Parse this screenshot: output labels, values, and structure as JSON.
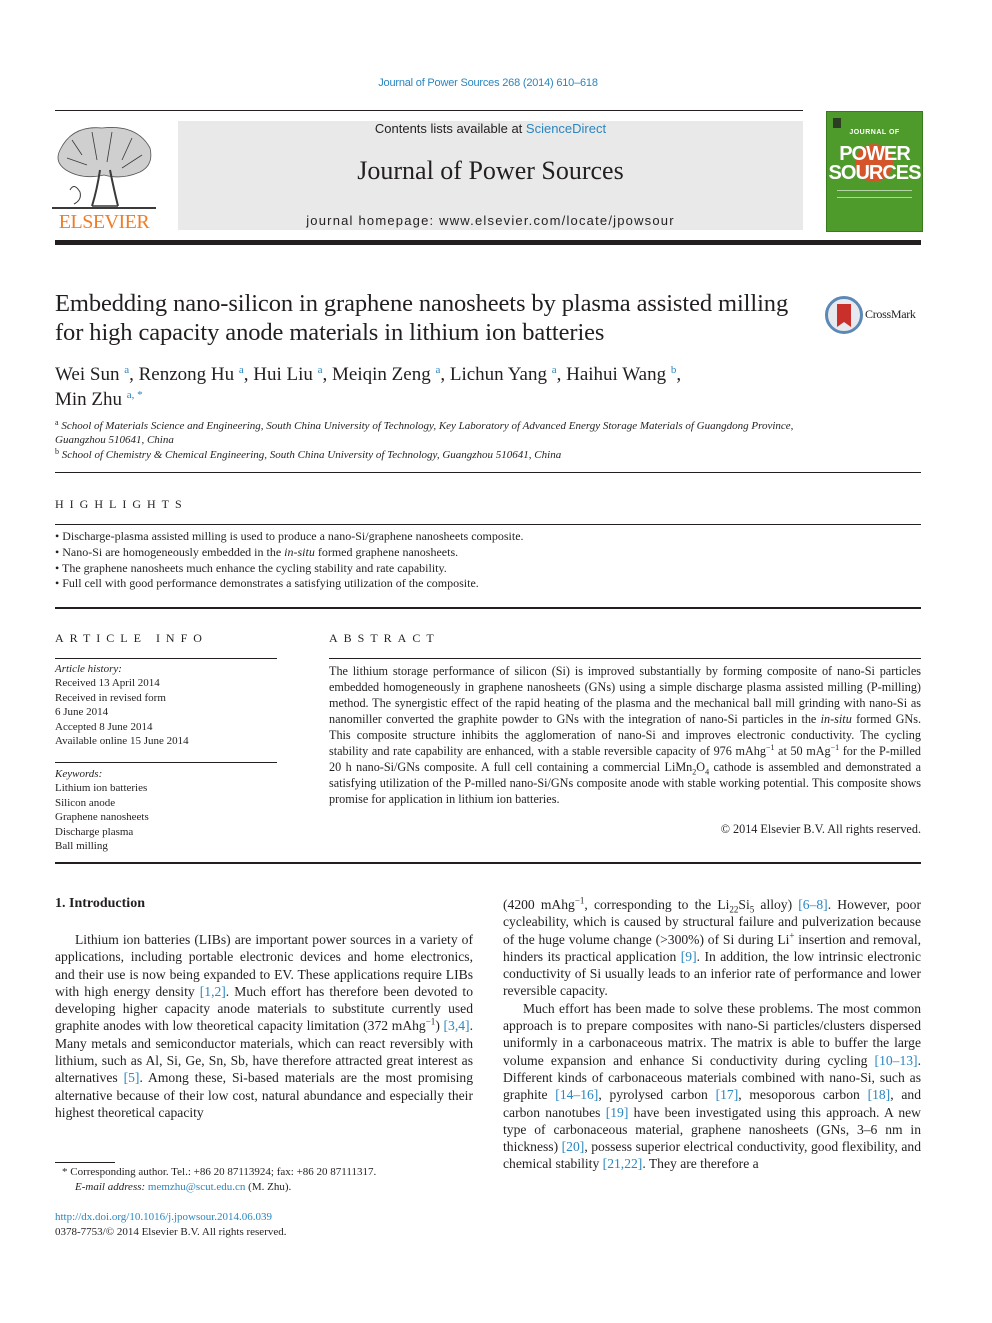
{
  "header": {
    "journal_reference": "Journal of Power Sources 268 (2014) 610–618",
    "contents_prefix": "Contents lists available at ",
    "contents_link": "ScienceDirect",
    "journal_name": "Journal of Power Sources",
    "homepage": "journal homepage: www.elsevier.com/locate/jpowsour",
    "publisher_logo_text": "ELSEVIER",
    "cover": {
      "top_text": "JOURNAL OF",
      "line1": "POWER",
      "line2": "SOURCES",
      "background_color": "#4e9a2b"
    },
    "publisher_color": "#f07d26",
    "link_color": "#2a86c0"
  },
  "article": {
    "title": "Embedding nano-silicon in graphene nanosheets by plasma assisted milling for high capacity anode materials in lithium ion batteries",
    "crossmark_label": "CrossMark",
    "authors": [
      {
        "name": "Wei Sun",
        "aff": "a",
        "sep": ", "
      },
      {
        "name": "Renzong Hu",
        "aff": "a",
        "sep": ", "
      },
      {
        "name": "Hui Liu",
        "aff": "a",
        "sep": ", "
      },
      {
        "name": "Meiqin Zeng",
        "aff": "a",
        "sep": ", "
      },
      {
        "name": "Lichun Yang",
        "aff": "a",
        "sep": ", "
      },
      {
        "name": "Haihui Wang",
        "aff": "b",
        "sep": ","
      },
      {
        "name": "Min Zhu",
        "aff": "a, *",
        "sep": ""
      }
    ],
    "affiliations": [
      {
        "key": "a",
        "text": "School of Materials Science and Engineering, South China University of Technology, Key Laboratory of Advanced Energy Storage Materials of Guangdong Province, Guangzhou 510641, China"
      },
      {
        "key": "b",
        "text": "School of Chemistry & Chemical Engineering, South China University of Technology, Guangzhou 510641, China"
      }
    ]
  },
  "highlights": {
    "heading": "HIGHLIGHTS",
    "items": [
      "Discharge-plasma assisted milling is used to produce a nano-Si/graphene nanosheets composite.",
      "Nano-Si are homogeneously embedded in the in-situ formed graphene nanosheets.",
      "The graphene nanosheets much enhance the cycling stability and rate capability.",
      "Full cell with good performance demonstrates a satisfying utilization of the composite."
    ]
  },
  "article_info": {
    "heading": "ARTICLE INFO",
    "history_label": "Article history:",
    "history": [
      "Received 13 April 2014",
      "Received in revised form",
      "6 June 2014",
      "Accepted 8 June 2014",
      "Available online 15 June 2014"
    ],
    "keywords_label": "Keywords:",
    "keywords": [
      "Lithium ion batteries",
      "Silicon anode",
      "Graphene nanosheets",
      "Discharge plasma",
      "Ball milling"
    ]
  },
  "abstract": {
    "heading": "ABSTRACT",
    "part1": "The lithium storage performance of silicon (Si) is improved substantially by forming composite of nano-Si particles embedded homogeneously in graphene nanosheets (GNs) using a simple discharge plasma assisted milling (P-milling) method. The synergistic effect of the rapid heating of the plasma and the mechanical ball mill grinding with nano-Si as nanomiller converted the graphite powder to GNs with the integration of nano-Si particles in the ",
    "italic1": "in-situ",
    "part2": " formed GNs. This composite structure inhibits the agglomeration of nano-Si and improves electronic conductivity. The cycling stability and rate capability are enhanced, with a stable reversible capacity of 976 mAhg",
    "sup1": "−1",
    "part3": " at 50 mAg",
    "sup2": "−1",
    "part4": " for the P-milled 20 h nano-Si/GNs composite. A full cell containing a commercial LiMn",
    "sub1": "2",
    "part5": "O",
    "sub2": "4",
    "part6": " cathode is assembled and demonstrated a satisfying utilization of the P-milled nano-Si/GNs composite anode with stable working potential. This composite shows promise for application in lithium ion batteries.",
    "copyright": "© 2014 Elsevier B.V. All rights reserved."
  },
  "introduction": {
    "heading": "1.  Introduction",
    "left": {
      "t1": "Lithium ion batteries (LIBs) are important power sources in a variety of applications, including portable electronic devices and home electronics, and their use is now being expanded to EV. These applications require LIBs with high energy density ",
      "r1": "[1,2]",
      "t2": ". Much effort has therefore been devoted to developing higher capacity anode materials to substitute currently used graphite anodes with low theoretical capacity limitation (372 mAhg",
      "sup1": "−1",
      "t3": ") ",
      "r2": "[3,4]",
      "t4": ". Many metals and semiconductor materials, which can react reversibly with lithium, such as Al, Si, Ge, Sn, Sb, have therefore attracted great interest as alternatives ",
      "r3": "[5]",
      "t5": ". Among these, Si-based materials are the most promising alternative because of their low cost, natural abundance and especially their highest theoretical capacity"
    },
    "right_p1": {
      "t1": "(4200 mAhg",
      "sup1": "−1",
      "t2": ", corresponding to the Li",
      "sub1": "22",
      "t3": "Si",
      "sub2": "5",
      "t4": " alloy) ",
      "r1": "[6–8]",
      "t5": ". However, poor cycleability, which is caused by structural failure and pulverization because of the huge volume change (>300%) of Si during Li",
      "sup2": "+",
      "t6": " insertion and removal, hinders its practical application ",
      "r2": "[9]",
      "t7": ". In addition, the low intrinsic electronic conductivity of Si usually leads to an inferior rate of performance and lower reversible capacity."
    },
    "right_p2": {
      "t1": "Much effort has been made to solve these problems. The most common approach is to prepare composites with nano-Si particles/clusters dispersed uniformly in a carbonaceous matrix. The matrix is able to buffer the large volume expansion and enhance Si conductivity during cycling ",
      "r1": "[10–13]",
      "t2": ". Different kinds of carbonaceous materials combined with nano-Si, such as graphite ",
      "r2": "[14–16]",
      "t3": ", pyrolysed carbon ",
      "r3": "[17]",
      "t4": ", mesoporous carbon ",
      "r4": "[18]",
      "t5": ", and carbon nanotubes ",
      "r5": "[19]",
      "t6": " have been investigated using this approach. A new type of carbonaceous material, graphene nanosheets (GNs, 3–6 nm in thickness) ",
      "r6": "[20]",
      "t7": ", possess superior electrical conductivity, good flexibility, and chemical stability ",
      "r7": "[21,22]",
      "t8": ". They are therefore a"
    }
  },
  "footnote": {
    "marker": "*",
    "corresponding": " Corresponding author. Tel.: +86 20 87113924; fax: +86 20 87111317.",
    "email_label": "E-mail address: ",
    "email": "memzhu@scut.edu.cn",
    "email_suffix": " (M. Zhu)."
  },
  "doi": {
    "url": "http://dx.doi.org/10.1016/j.jpowsour.2014.06.039",
    "issn_line": "0378-7753/© 2014 Elsevier B.V. All rights reserved."
  }
}
